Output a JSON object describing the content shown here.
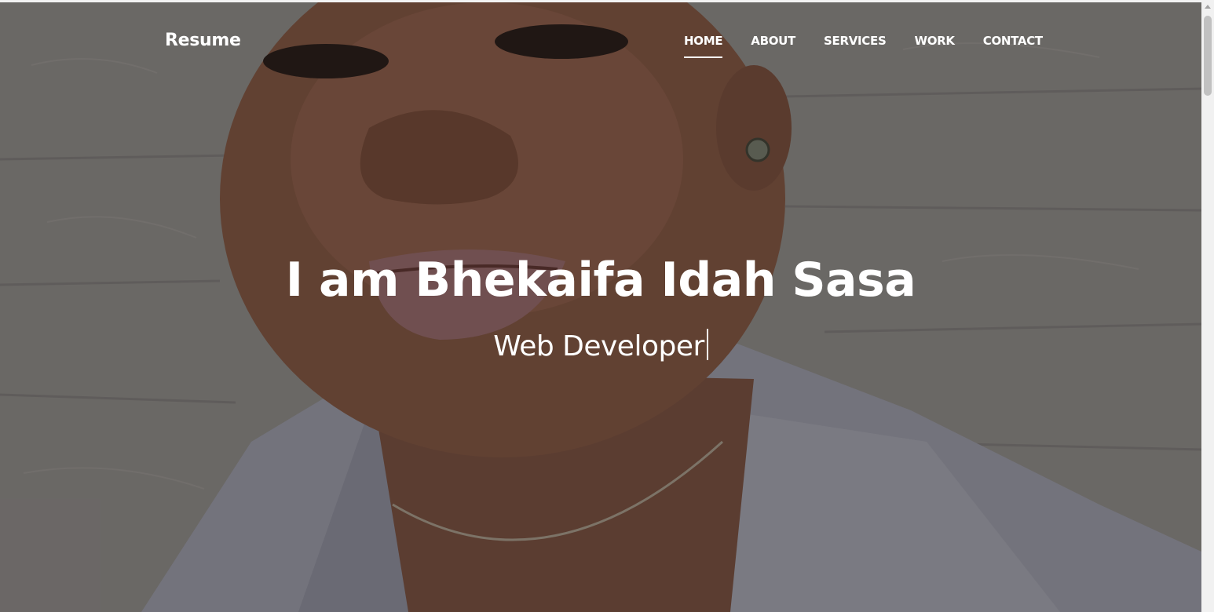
{
  "brand": "Resume",
  "nav": {
    "items": [
      {
        "label": "HOME",
        "active": true
      },
      {
        "label": "ABOUT",
        "active": false
      },
      {
        "label": "SERVICES",
        "active": false
      },
      {
        "label": "WORK",
        "active": false
      },
      {
        "label": "CONTACT",
        "active": false
      }
    ]
  },
  "hero": {
    "title": "I am Bhekaifa Idah Sasa",
    "subtitle": "Web Developer"
  },
  "colors": {
    "text": "#ffffff",
    "overlay": "#141216"
  }
}
